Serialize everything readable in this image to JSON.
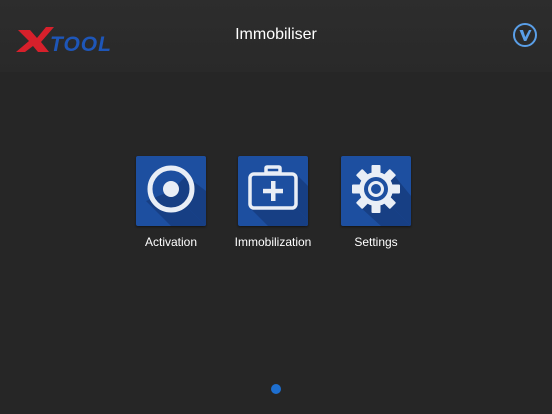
{
  "header": {
    "logo_text": "XTOOL",
    "title": "Immobiliser",
    "badge_letter": "V"
  },
  "apps": [
    {
      "label": "Activation",
      "icon": "target-icon"
    },
    {
      "label": "Immobilization",
      "icon": "first-aid-kit-icon"
    },
    {
      "label": "Settings",
      "icon": "gear-icon"
    }
  ],
  "pager": {
    "pages": 1,
    "active": 1
  },
  "colors": {
    "background": "#262626",
    "tile": "#1d4fa0",
    "logo_red": "#d7202b",
    "logo_blue": "#1e56b8",
    "dot": "#1e6fd0"
  }
}
